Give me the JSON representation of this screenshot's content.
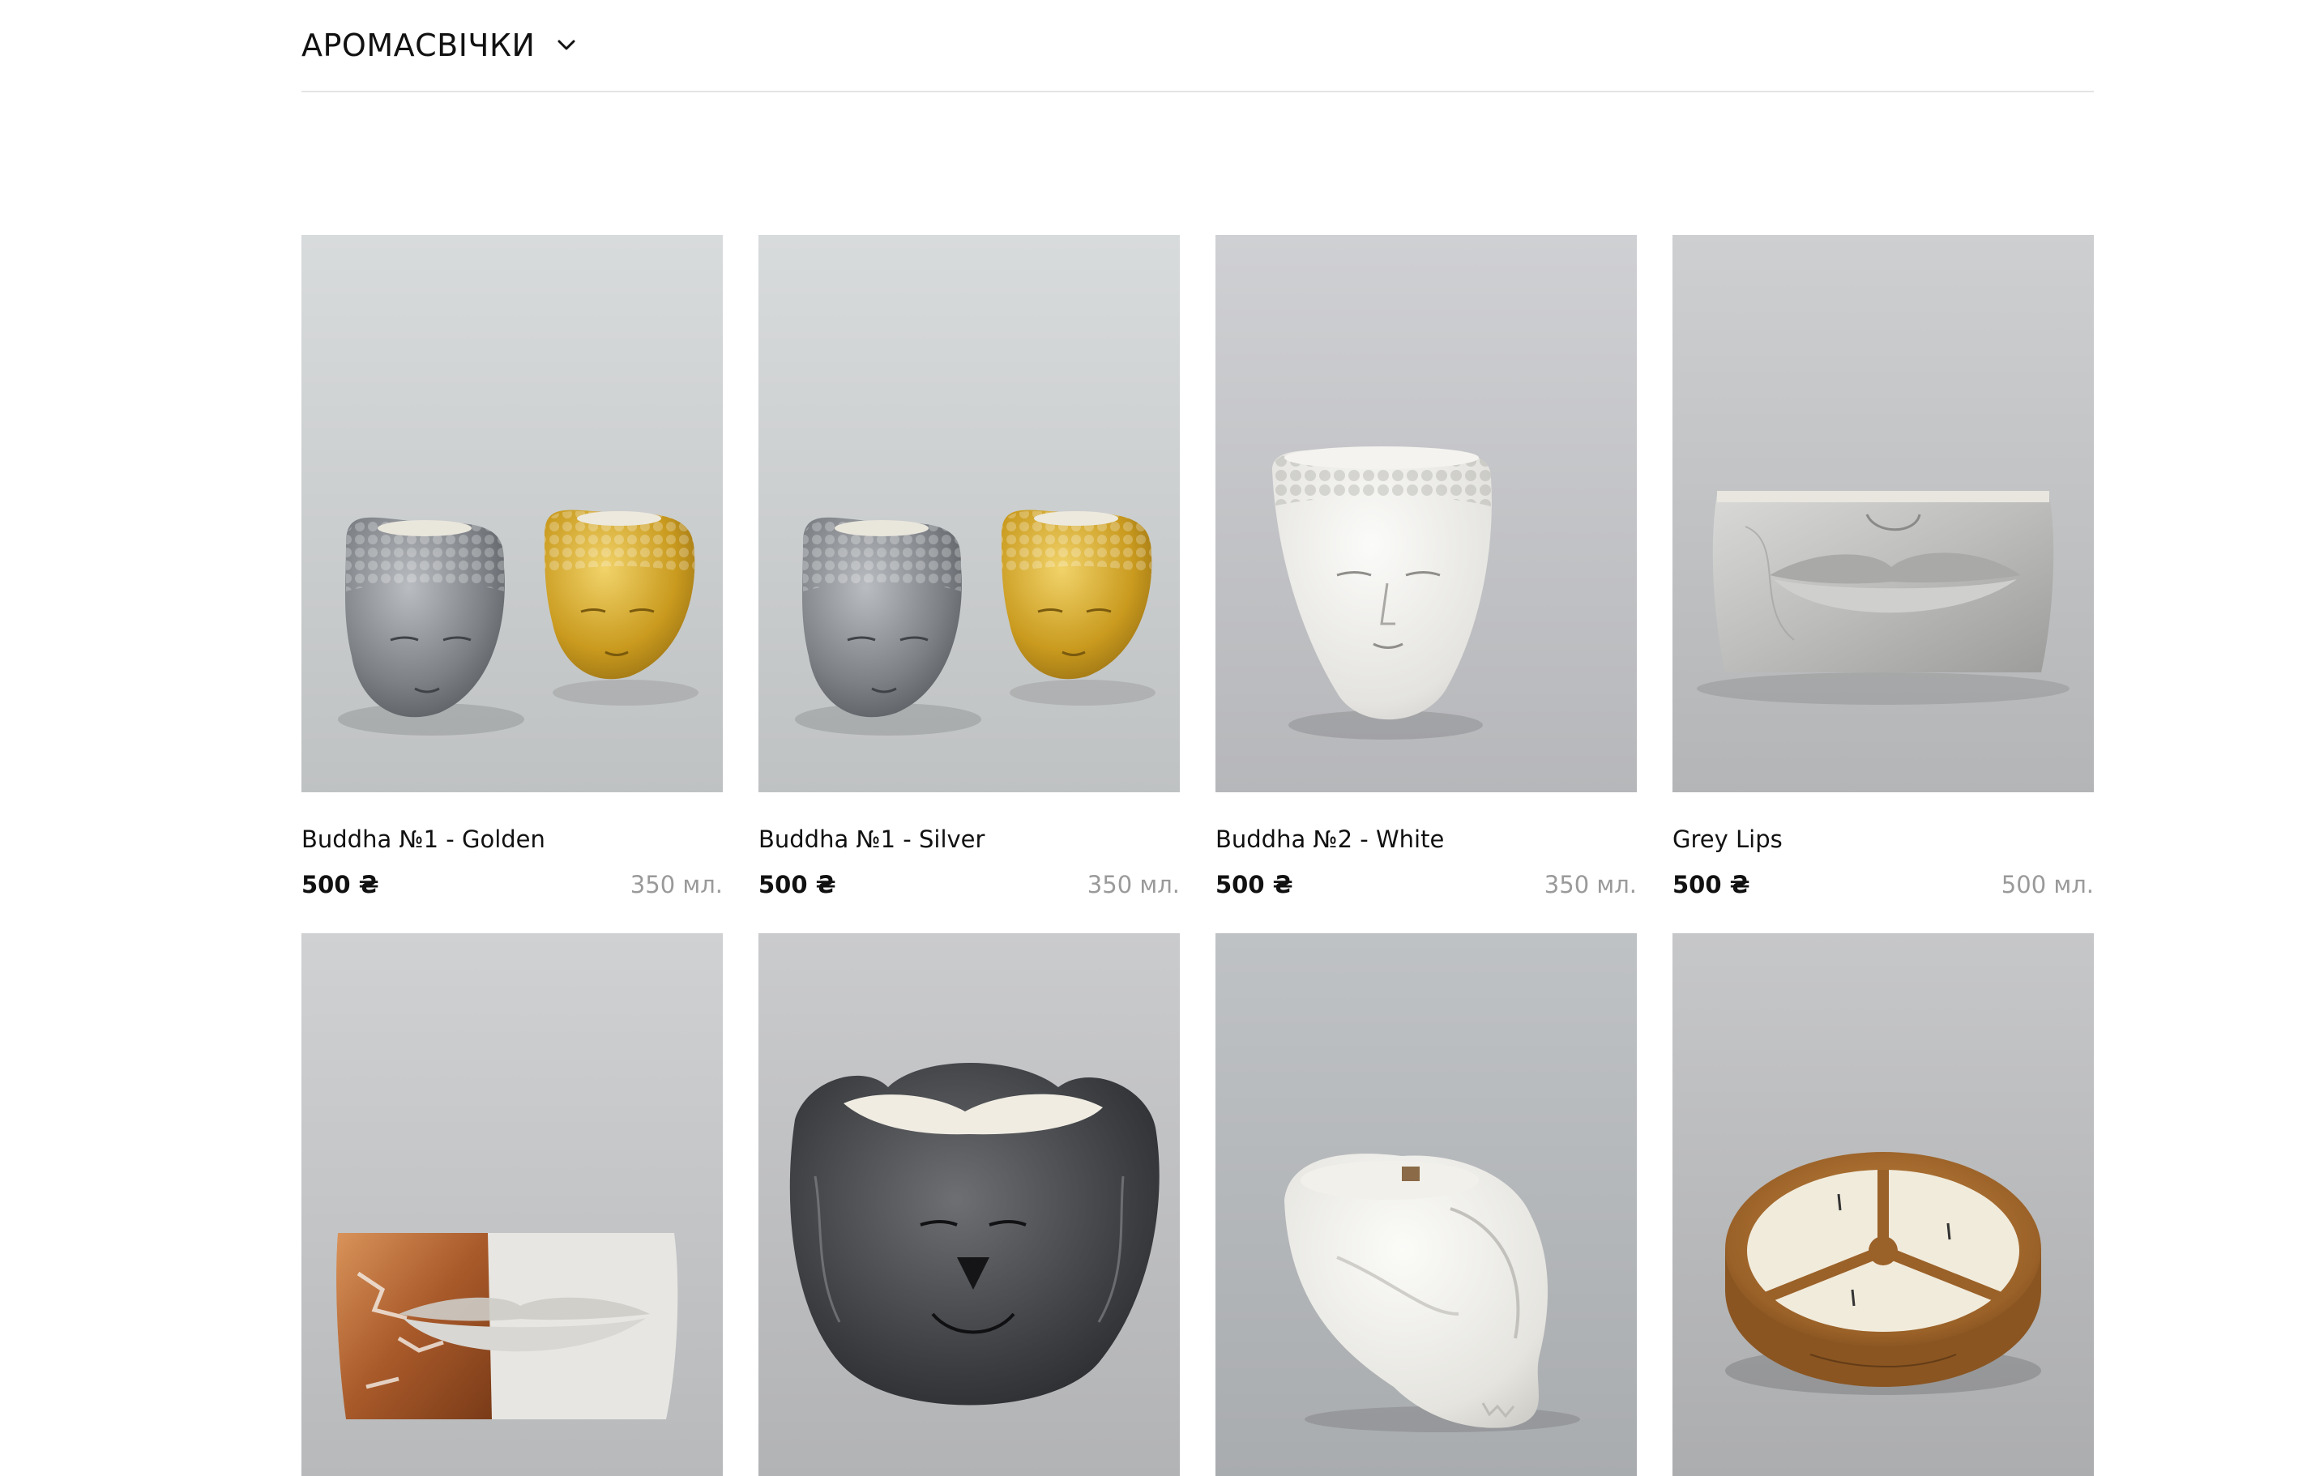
{
  "category": {
    "title": "АРОМАСВІЧКИ",
    "toggle_icon": "chevron-down-icon"
  },
  "products": [
    {
      "name": "Buddha №1 - Golden",
      "price": "500 ₴",
      "volume": "350 мл.",
      "image": "silver-and-gold-buddha-head-candles"
    },
    {
      "name": "Buddha №1 - Silver",
      "price": "500 ₴",
      "volume": "350 мл.",
      "image": "silver-and-gold-buddha-head-candles"
    },
    {
      "name": "Buddha №2 - White",
      "price": "500 ₴",
      "volume": "350 мл.",
      "image": "white-buddha-head-candle"
    },
    {
      "name": "Grey Lips",
      "price": "500 ₴",
      "volume": "500 мл.",
      "image": "grey-marble-lips-candle"
    },
    {
      "image": "copper-leaf-lips-candle"
    },
    {
      "image": "black-lion-head-candle"
    },
    {
      "image": "white-crouching-figure-candle"
    },
    {
      "image": "wooden-three-wick-candle-bowl"
    }
  ],
  "colors": {
    "text": "#111111",
    "muted": "#9a9a9a",
    "divider": "#e4e4e4",
    "background": "#ffffff"
  }
}
